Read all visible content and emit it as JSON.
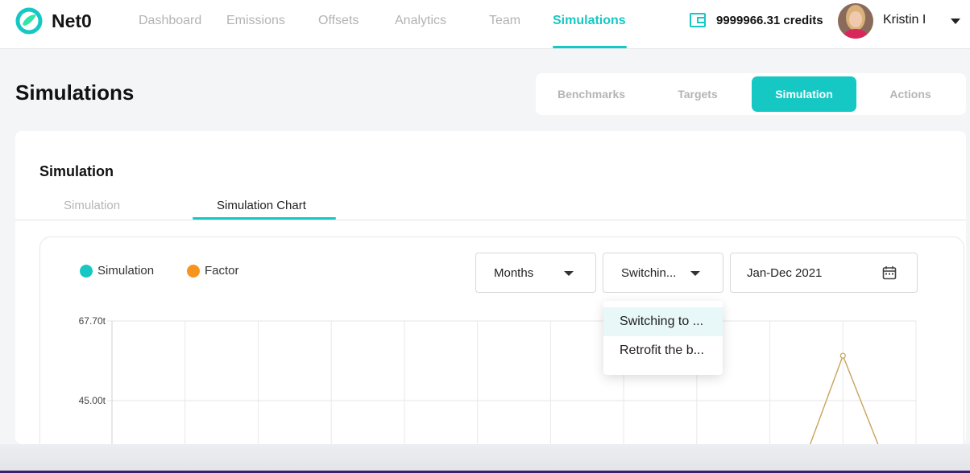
{
  "app": {
    "name": "Net0"
  },
  "nav": {
    "items": [
      {
        "label": "Dashboard"
      },
      {
        "label": "Emissions"
      },
      {
        "label": "Offsets"
      },
      {
        "label": "Analytics"
      },
      {
        "label": "Team"
      },
      {
        "label": "Simulations"
      }
    ],
    "active": "Simulations"
  },
  "account": {
    "credits": "9999966.31 credits",
    "user_name": "Kristin I"
  },
  "page": {
    "title": "Simulations"
  },
  "segmented": {
    "items": [
      {
        "label": "Benchmarks"
      },
      {
        "label": "Targets"
      },
      {
        "label": "Simulation"
      },
      {
        "label": "Actions"
      }
    ],
    "active": "Simulation"
  },
  "card": {
    "title": "Simulation",
    "tabs": [
      {
        "label": "Simulation"
      },
      {
        "label": "Simulation Chart"
      }
    ],
    "active_tab": "Simulation Chart"
  },
  "filters": {
    "period": "Months",
    "action": "Switchin...",
    "date_range": "Jan-Dec 2021",
    "action_options": [
      {
        "label": "Switching to ..."
      },
      {
        "label": "Retrofit the b..."
      }
    ],
    "highlighted_option": "Switching to ..."
  },
  "colors": {
    "accent": "#16c8c4",
    "factor": "#f7941d",
    "factor_line": "#c9a35a",
    "text_muted": "#b3b3b3"
  },
  "chart_data": {
    "type": "line",
    "legend": [
      {
        "name": "Simulation",
        "color": "#16c8c4"
      },
      {
        "name": "Factor",
        "color": "#f7941d"
      }
    ],
    "ytick_labels": [
      "67.70t",
      "45.00t"
    ],
    "ytick_values": [
      67.7,
      45.0
    ],
    "x_slots": 11,
    "series": [
      {
        "name": "Factor",
        "color": "#c9a35a",
        "points": [
          {
            "slot": 10,
            "value": 57.8
          }
        ]
      }
    ],
    "grid": true
  }
}
